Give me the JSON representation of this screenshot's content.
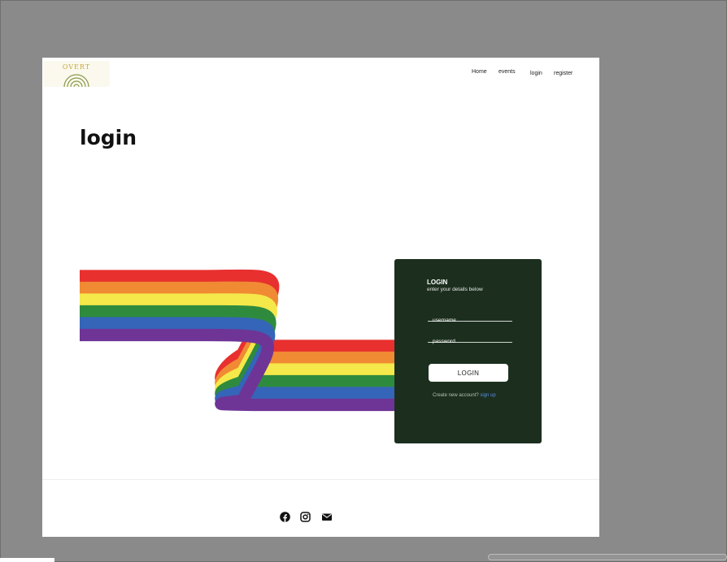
{
  "brand": {
    "logo_text": "OVERT"
  },
  "nav": {
    "home": "Home",
    "events": "events",
    "login": "login",
    "register": "register"
  },
  "page": {
    "title": "login"
  },
  "login_card": {
    "title": "LOGIN",
    "subtitle": "enter your details below",
    "username_placeholder": "username",
    "password_placeholder": "password",
    "button_label": "LOGIN",
    "signup_prompt": "Create new account?",
    "signup_link": "sign up"
  },
  "rainbow": {
    "colors": [
      "#e8302f",
      "#f08a33",
      "#f5e84a",
      "#2e8b3e",
      "#3565b8",
      "#6e3596"
    ]
  },
  "footer": {
    "icons": [
      "facebook-icon",
      "instagram-icon",
      "mail-icon"
    ]
  },
  "colors": {
    "card_bg": "#1c2f1e",
    "link": "#5a8fe0",
    "backdrop": "#8a8a8a"
  }
}
